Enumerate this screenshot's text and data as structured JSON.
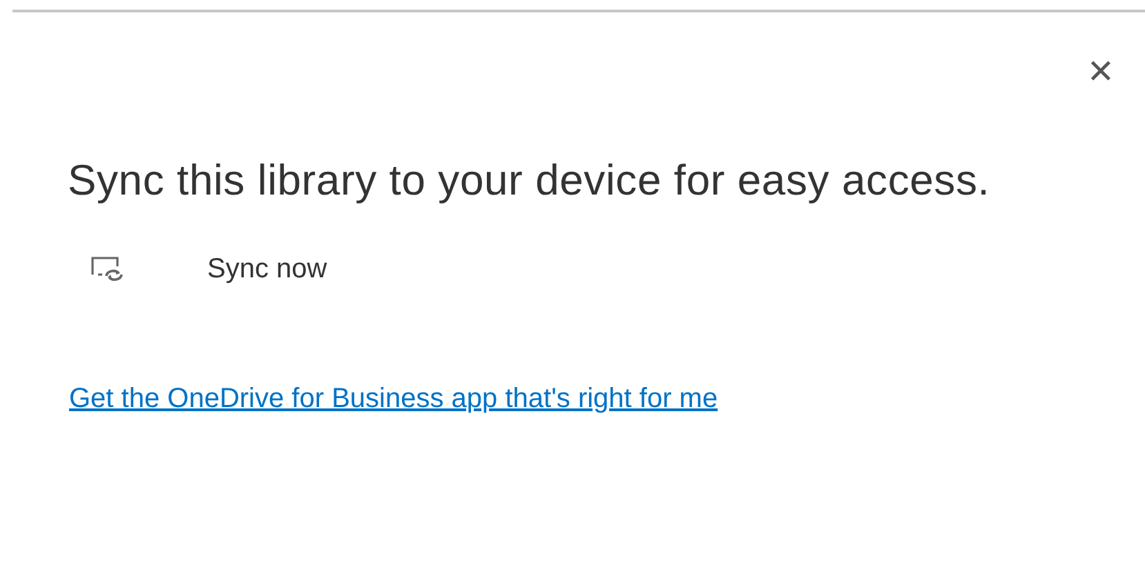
{
  "close_button": {
    "label": "✕"
  },
  "heading": "Sync this library to your device for easy access.",
  "actions": [
    {
      "label": "Sync now"
    }
  ],
  "link": "Get the OneDrive for Business app that's right for me"
}
